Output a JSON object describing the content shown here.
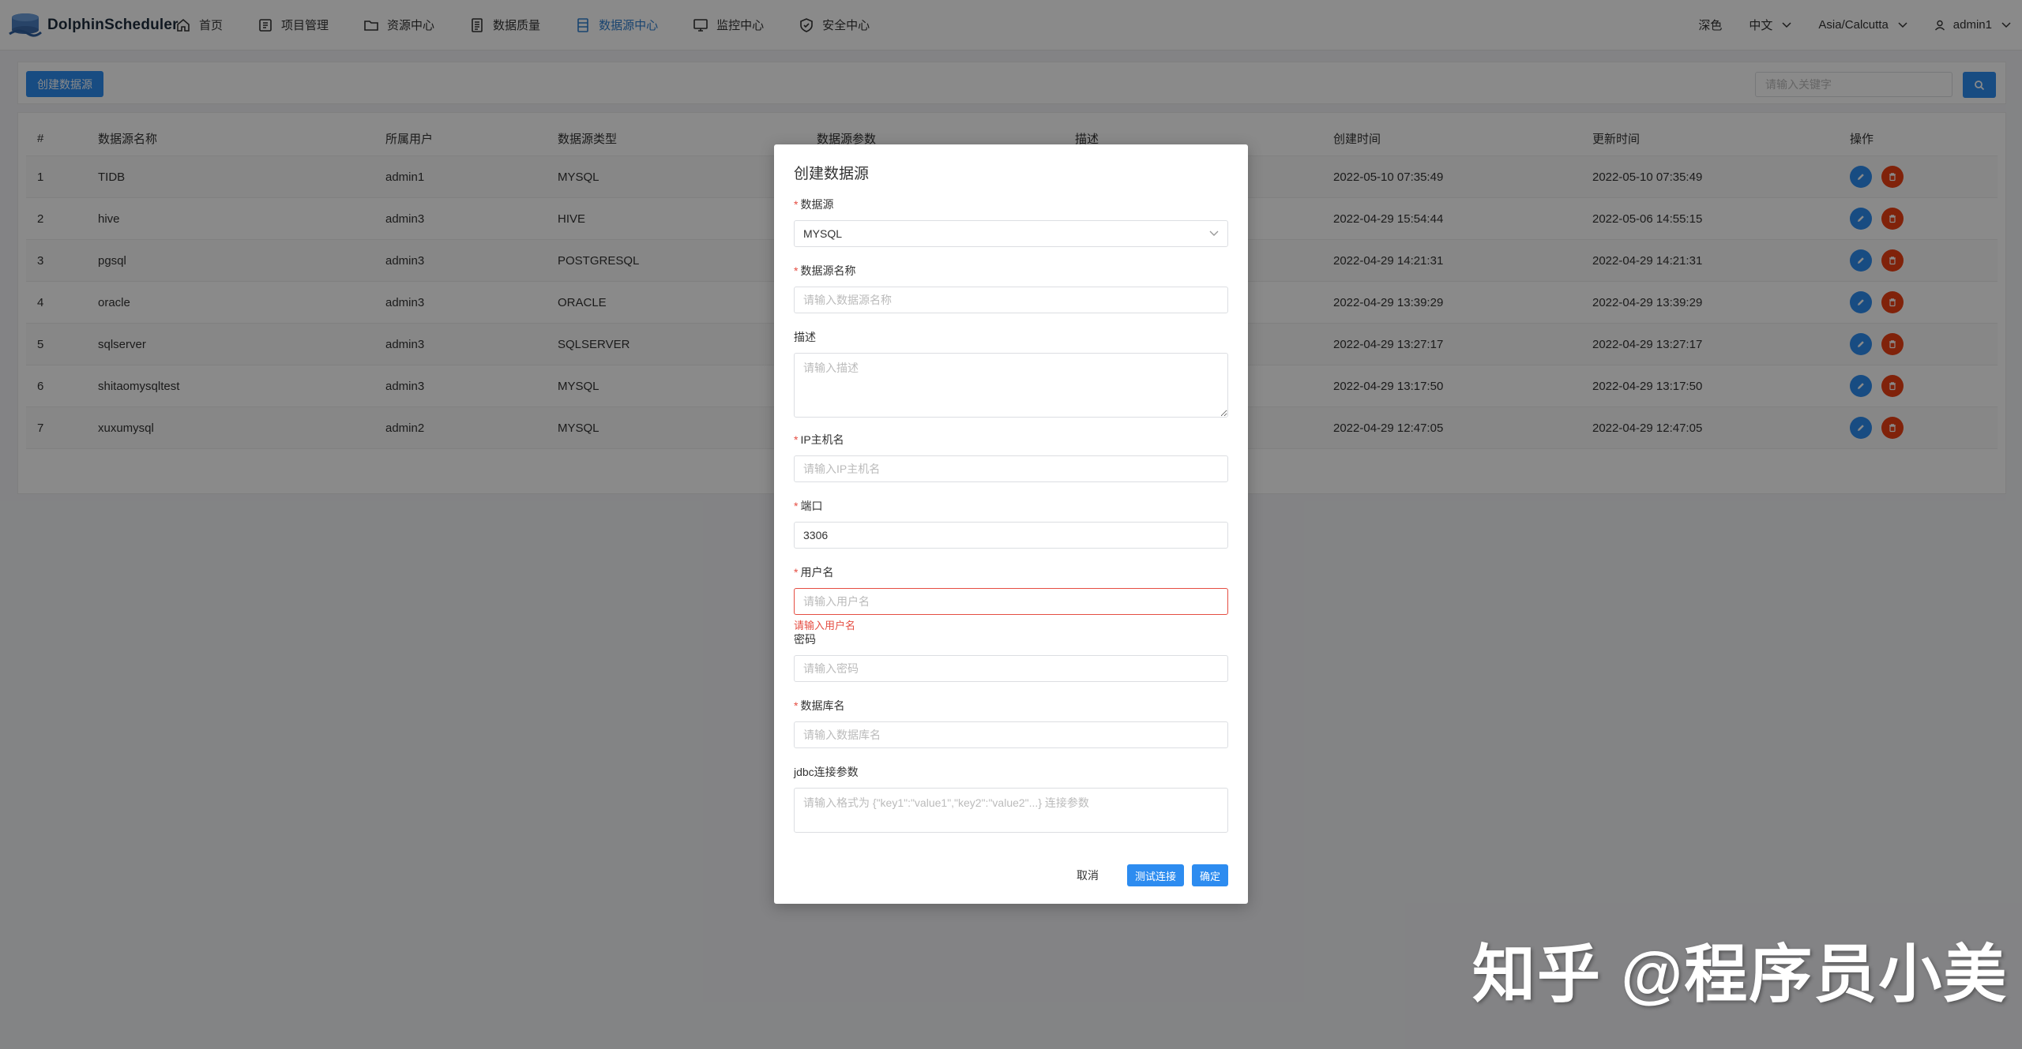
{
  "header": {
    "brand": "DolphinScheduler",
    "nav": [
      {
        "label": "首页",
        "icon": "home-icon"
      },
      {
        "label": "项目管理",
        "icon": "project-icon"
      },
      {
        "label": "资源中心",
        "icon": "folder-icon"
      },
      {
        "label": "数据质量",
        "icon": "data-quality-icon"
      },
      {
        "label": "数据源中心",
        "icon": "datasource-icon",
        "active": true
      },
      {
        "label": "监控中心",
        "icon": "monitor-icon"
      },
      {
        "label": "安全中心",
        "icon": "shield-icon"
      }
    ],
    "theme": "深色",
    "language": "中文",
    "timezone": "Asia/Calcutta",
    "user": "admin1"
  },
  "toolbar": {
    "create_label": "创建数据源",
    "search_placeholder": "请输入关键字"
  },
  "table": {
    "columns": [
      "#",
      "数据源名称",
      "所属用户",
      "数据源类型",
      "数据源参数",
      "描述",
      "创建时间",
      "更新时间",
      "操作"
    ],
    "rows": [
      {
        "idx": "1",
        "name": "TIDB",
        "user": "admin1",
        "type": "MYSQL",
        "created": "2022-05-10 07:35:49",
        "updated": "2022-05-10 07:35:49"
      },
      {
        "idx": "2",
        "name": "hive",
        "user": "admin3",
        "type": "HIVE",
        "created": "2022-04-29 15:54:44",
        "updated": "2022-05-06 14:55:15"
      },
      {
        "idx": "3",
        "name": "pgsql",
        "user": "admin3",
        "type": "POSTGRESQL",
        "created": "2022-04-29 14:21:31",
        "updated": "2022-04-29 14:21:31"
      },
      {
        "idx": "4",
        "name": "oracle",
        "user": "admin3",
        "type": "ORACLE",
        "created": "2022-04-29 13:39:29",
        "updated": "2022-04-29 13:39:29"
      },
      {
        "idx": "5",
        "name": "sqlserver",
        "user": "admin3",
        "type": "SQLSERVER",
        "created": "2022-04-29 13:27:17",
        "updated": "2022-04-29 13:27:17"
      },
      {
        "idx": "6",
        "name": "shitaomysqltest",
        "user": "admin3",
        "type": "MYSQL",
        "created": "2022-04-29 13:17:50",
        "updated": "2022-04-29 13:17:50"
      },
      {
        "idx": "7",
        "name": "xuxumysql",
        "user": "admin2",
        "type": "MYSQL",
        "created": "2022-04-29 12:47:05",
        "updated": "2022-04-29 12:47:05"
      }
    ]
  },
  "modal": {
    "title": "创建数据源",
    "datasource_label": "数据源",
    "datasource_value": "MYSQL",
    "name_label": "数据源名称",
    "name_placeholder": "请输入数据源名称",
    "desc_label": "描述",
    "desc_placeholder": "请输入描述",
    "host_label": "IP主机名",
    "host_placeholder": "请输入IP主机名",
    "port_label": "端口",
    "port_value": "3306",
    "user_label": "用户名",
    "user_placeholder": "请输入用户名",
    "user_error": "请输入用户名",
    "password_label": "密码",
    "password_placeholder": "请输入密码",
    "db_label": "数据库名",
    "db_placeholder": "请输入数据库名",
    "jdbc_label": "jdbc连接参数",
    "jdbc_placeholder": "请输入格式为 {\"key1\":\"value1\",\"key2\":\"value2\"...} 连接参数",
    "cancel_label": "取消",
    "test_label": "测试连接",
    "confirm_label": "确定"
  },
  "watermark": "知乎 @程序员小美",
  "colors": {
    "primary": "#2d8cf0",
    "danger": "#ed4014",
    "active_nav": "#2f7fd0",
    "error": "#e54d42"
  }
}
